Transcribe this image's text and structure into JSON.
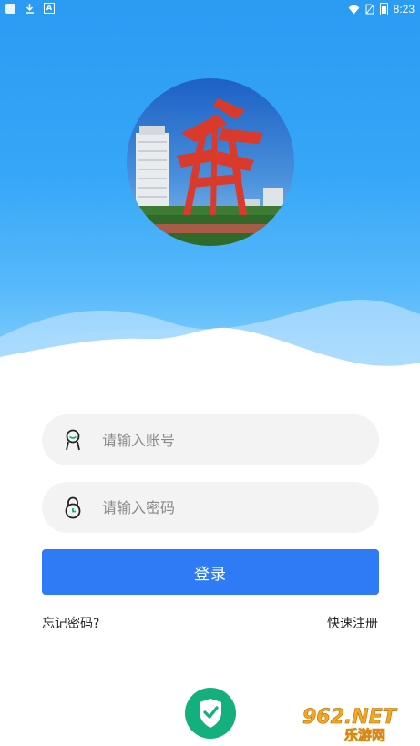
{
  "status_bar": {
    "time": "8:23"
  },
  "form": {
    "account_placeholder": "请输入账号",
    "password_placeholder": "请输入密码",
    "login_label": "登录",
    "forgot_label": "忘记密码?",
    "register_label": "快速注册"
  },
  "watermark": {
    "top": "962.NET",
    "bottom": "乐游网"
  },
  "colors": {
    "header_blue": "#36a6f7",
    "login_button": "#2f7bf6",
    "shield_green": "#13b07d",
    "input_bg": "#f3f3f3"
  },
  "icons": [
    "download-icon",
    "a-icon",
    "wifi-icon",
    "no-sim-icon",
    "battery-icon",
    "user-icon",
    "lock-icon",
    "shield-check-icon"
  ]
}
